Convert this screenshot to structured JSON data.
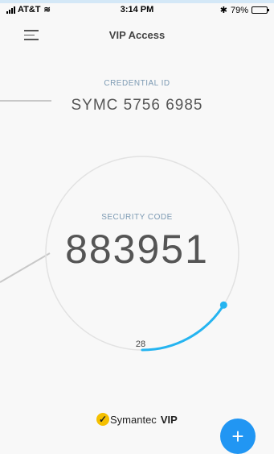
{
  "status_bar": {
    "carrier": "AT&T",
    "wifi_icon": "wifi-icon",
    "time": "3:14 PM",
    "bluetooth": "✱",
    "battery_percent": "79%",
    "battery_level": 0.79
  },
  "nav": {
    "title": "VIP Access",
    "menu_icon": "hamburger-menu-icon"
  },
  "credential": {
    "label": "CREDENTIAL ID",
    "value": "SYMC 5756 6985"
  },
  "security": {
    "label": "SECURITY CODE",
    "code": "883951",
    "seconds_remaining": "28",
    "progress": 0.16
  },
  "brand": {
    "name": "Symantec",
    "suffix": "VIP",
    "logo_icon": "symantec-check-icon"
  },
  "fab": {
    "label": "+",
    "icon": "plus-icon"
  },
  "colors": {
    "accent": "#2196f3",
    "label_blue": "#7c9ab3",
    "ring": "#e2e2e2",
    "progress": "#25b4f0"
  }
}
